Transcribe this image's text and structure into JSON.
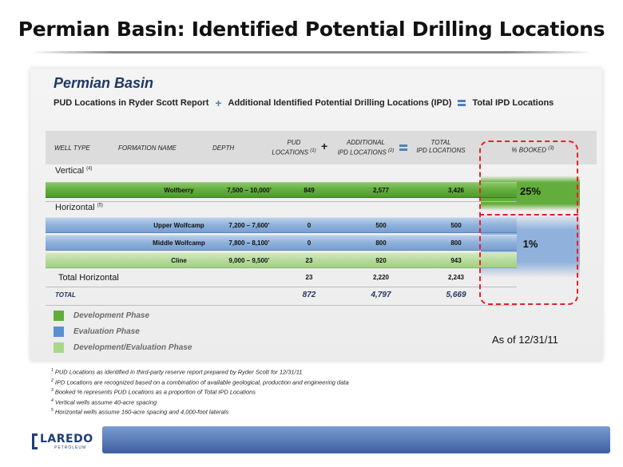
{
  "title": "Permian Basin: Identified Potential Drilling Locations",
  "panel": {
    "title": "Permian Basin",
    "legend_pud": "PUD Locations in Ryder Scott Report",
    "legend_plus": "+",
    "legend_additional": "Additional Identified Potential Drilling Locations (IPD)",
    "legend_total": "Total IPD Locations"
  },
  "headers": {
    "well_type": "WELL TYPE",
    "formation": "FORMATION NAME",
    "depth": "DEPTH",
    "pud_line1": "PUD",
    "pud_line2": "LOCATIONS",
    "pud_note": "(1)",
    "plus": "+",
    "additional_line1": "ADDITIONAL",
    "additional_line2": "IPD LOCATIONS",
    "additional_note": "(2)",
    "total_line1": "TOTAL",
    "total_line2": "IPD LOCATIONS",
    "booked": "% BOOKED",
    "booked_note": "(3)"
  },
  "sections": {
    "vertical": "Vertical",
    "vertical_note": "(4)",
    "horizontal": "Horizontal",
    "horizontal_note": "(5)"
  },
  "rows": {
    "wolfberry": {
      "formation": "Wolfberry",
      "depth": "7,500 – 10,000’",
      "pud": "849",
      "additional": "2,577",
      "total": "3,426"
    },
    "upper_wolfcamp": {
      "formation": "Upper Wolfcamp",
      "depth": "7,200 – 7,600’",
      "pud": "0",
      "additional": "500",
      "total": "500"
    },
    "middle_wolfcamp": {
      "formation": "Middle Wolfcamp",
      "depth": "7,800 – 8,100’",
      "pud": "0",
      "additional": "800",
      "total": "800"
    },
    "cline": {
      "formation": "Cline",
      "depth": "9,000 – 9,500’",
      "pud": "23",
      "additional": "920",
      "total": "943"
    },
    "total_horizontal": {
      "label": "Total Horizontal",
      "pud": "23",
      "additional": "2,220",
      "total": "2,243"
    },
    "total": {
      "label": "TOTAL",
      "pud": "872",
      "additional": "4,797",
      "total": "5,669"
    }
  },
  "booked": {
    "vertical": "25%",
    "horizontal": "1%"
  },
  "phase_legend": [
    {
      "label": "Development Phase",
      "color": "#62ad3c"
    },
    {
      "label": "Evaluation Phase",
      "color": "#5b8fd4"
    },
    {
      "label": "Development/Evaluation Phase",
      "color": "#a8d78a"
    }
  ],
  "as_of": "As of 12/31/11",
  "footnotes": [
    {
      "num": "1",
      "text": "PUD Locations as identified in third-party reserve report prepared by Ryder Scott for 12/31/11"
    },
    {
      "num": "2",
      "text": "IPD Locations are recognized based on a combination of available geological, production and engineering data"
    },
    {
      "num": "3",
      "text": "Booked % represents PUD Locations as a proportion of Total IPD Locations"
    },
    {
      "num": "4",
      "text": "Vertical wells assume 40-acre spacing"
    },
    {
      "num": "5",
      "text": "Horizontal wells assume 160-acre spacing and 4,000-foot laterals"
    }
  ],
  "logo": {
    "word": "LAREDO",
    "sub": "PETROLEUM"
  }
}
